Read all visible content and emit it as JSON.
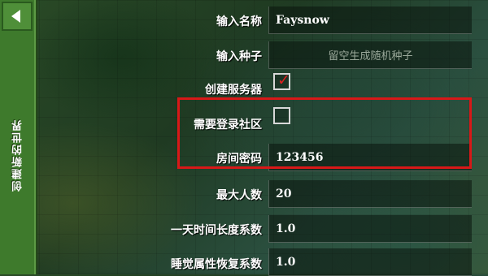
{
  "sidebar": {
    "back_icon": "back-arrow-icon",
    "title": "创建新的世界"
  },
  "form": {
    "name": {
      "label": "输入名称",
      "value": "Faysnow"
    },
    "seed": {
      "label": "输入种子",
      "placeholder": "留空生成随机种子"
    },
    "create_server": {
      "label": "创建服务器",
      "checked": true
    },
    "require_login": {
      "label": "需要登录社区",
      "checked": false
    },
    "room_password": {
      "label": "房间密码",
      "value": "123456"
    },
    "max_players": {
      "label": "最大人数",
      "value": "20"
    },
    "day_length": {
      "label": "一天时间长度系数",
      "value": "1.0"
    },
    "sleep_recovery": {
      "label": "睡觉属性恢复系数",
      "value": "1.0"
    }
  },
  "colors": {
    "sidebar": "#3e7a2c",
    "highlight": "#d81818",
    "checkmark": "#e02020"
  }
}
